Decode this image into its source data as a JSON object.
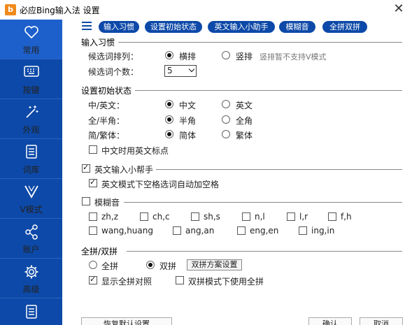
{
  "window": {
    "title": "必应Bing输入法 设置",
    "logo": "b",
    "close": "✕"
  },
  "sidebar": {
    "items": [
      {
        "label": "常用",
        "icon": "heart-icon"
      },
      {
        "label": "按键",
        "icon": "keyboard-icon"
      },
      {
        "label": "外观",
        "icon": "magic-wand-icon"
      },
      {
        "label": "词库",
        "icon": "book-icon"
      },
      {
        "label": "V模式",
        "icon": "v-icon"
      },
      {
        "label": "账户",
        "icon": "share-icon"
      },
      {
        "label": "高级",
        "icon": "gear-icon"
      },
      {
        "label": "",
        "icon": "list-icon"
      }
    ]
  },
  "tabs": [
    "输入习惯",
    "设置初始状态",
    "英文输入小助手",
    "模糊音",
    "全拼双拼"
  ],
  "habits": {
    "title": "输入习惯",
    "order_label": "候选词排列：",
    "order_opt1": "横排",
    "order_opt2": "竖排",
    "order_hint": "竖排暂不支持V模式",
    "count_label": "候选词个数：",
    "count_value": "5"
  },
  "initial": {
    "title": "设置初始状态",
    "lang_label": "中/英文：",
    "lang_opt1": "中文",
    "lang_opt2": "英文",
    "width_label": "全/半角：",
    "width_opt1": "半角",
    "width_opt2": "全角",
    "script_label": "简/繁体：",
    "script_opt1": "简体",
    "script_opt2": "繁体",
    "punct_label": "中文时用英文标点"
  },
  "english_helper": {
    "title": "英文输入小帮手",
    "space_label": "英文模式下空格选词自动加空格"
  },
  "fuzzy": {
    "title": "模糊音",
    "row1": [
      "zh,z",
      "ch,c",
      "sh,s",
      "n,l",
      "l,r",
      "f,h"
    ],
    "row2": [
      "wang,huang",
      "ang,an",
      "eng,en",
      "ing,in"
    ]
  },
  "pinyin": {
    "title": "全拼/双拼",
    "opt1": "全拼",
    "opt2": "双拼",
    "scheme_button": "双拼方案设置",
    "show_full_label": "显示全拼对照",
    "use_full_label": "双拼模式下使用全拼"
  },
  "footer": {
    "restore": "恢复默认设置",
    "ok": "确认",
    "cancel": "取消"
  },
  "colors": {
    "sidebar": "#0d49a8",
    "active": "#1d60cc",
    "pill": "#0d49a8"
  }
}
